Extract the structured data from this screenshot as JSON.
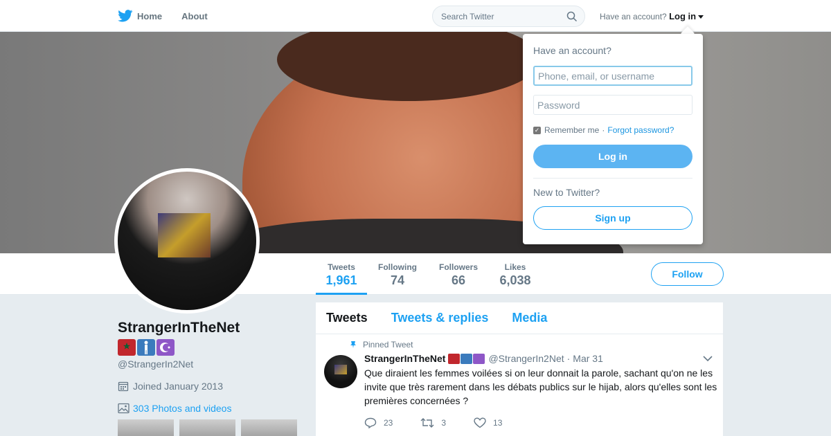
{
  "colors": {
    "accent": "#1da1f2",
    "nav_text": "#66757f",
    "body_bg": "#e6ecf0"
  },
  "topbar": {
    "logo_icon": "twitter-bird-icon",
    "home_label": "Home",
    "about_label": "About",
    "search_placeholder": "Search Twitter",
    "have_account_text": "Have an account?",
    "login_label": "Log in"
  },
  "profile": {
    "name": "StrangerInTheNet",
    "handle": "@StrangerIn2Net",
    "joined": "Joined January 2013",
    "photos_link": "303 Photos and videos",
    "name_emojis": [
      "morocco-flag-emoji",
      "person-standing-emoji",
      "star-crescent-emoji"
    ]
  },
  "stats": [
    {
      "label": "Tweets",
      "value": "1,961",
      "active": true
    },
    {
      "label": "Following",
      "value": "74",
      "active": false
    },
    {
      "label": "Followers",
      "value": "66",
      "active": false
    },
    {
      "label": "Likes",
      "value": "6,038",
      "active": false
    }
  ],
  "follow_label": "Follow",
  "timeline": {
    "tabs": [
      {
        "label": "Tweets",
        "active": true
      },
      {
        "label": "Tweets & replies",
        "active": false
      },
      {
        "label": "Media",
        "active": false
      }
    ],
    "tweet": {
      "pinned_label": "Pinned Tweet",
      "name": "StrangerInTheNet",
      "handle": "@StrangerIn2Net",
      "sep": "·",
      "date": "Mar 31",
      "text": "Que diraient les femmes voilées si on leur donnait la parole, sachant qu'on ne les invite que très rarement dans les débats publics sur le hijab, alors qu'elles sont les premières concernées ?",
      "replies": "23",
      "retweets": "3",
      "likes": "13"
    }
  },
  "login_dropdown": {
    "title": "Have an account?",
    "username_placeholder": "Phone, email, or username",
    "password_placeholder": "Password",
    "remember_label": "Remember me",
    "separator": "·",
    "forgot_label": "Forgot password?",
    "login_button": "Log in",
    "new_label": "New to Twitter?",
    "signup_button": "Sign up"
  }
}
